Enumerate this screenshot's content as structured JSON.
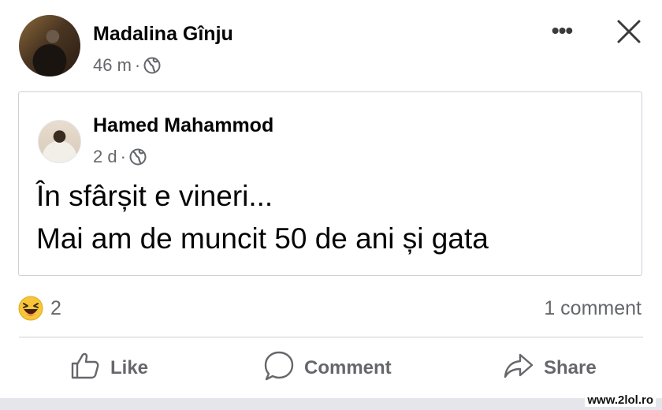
{
  "post": {
    "author": "Madalina Gînju",
    "time": "46 m",
    "separator": "·",
    "more_label": "•••"
  },
  "shared_post": {
    "author": "Hamed Mahammod",
    "time": "2 d",
    "separator": "·",
    "text_line1": "În sfârșit e vineri...",
    "text_line2": "Mai am de muncit 50 de ani și gata"
  },
  "reactions": {
    "icon": "laughing-emoji-icon",
    "count": "2",
    "comments": "1 comment"
  },
  "actions": {
    "like": "Like",
    "comment": "Comment",
    "share": "Share"
  },
  "watermark": "www.2lol.ro",
  "colors": {
    "text_primary": "#050505",
    "text_secondary": "#65676b",
    "border": "#ced0d4",
    "reaction_yellow": "#f7c53a"
  }
}
